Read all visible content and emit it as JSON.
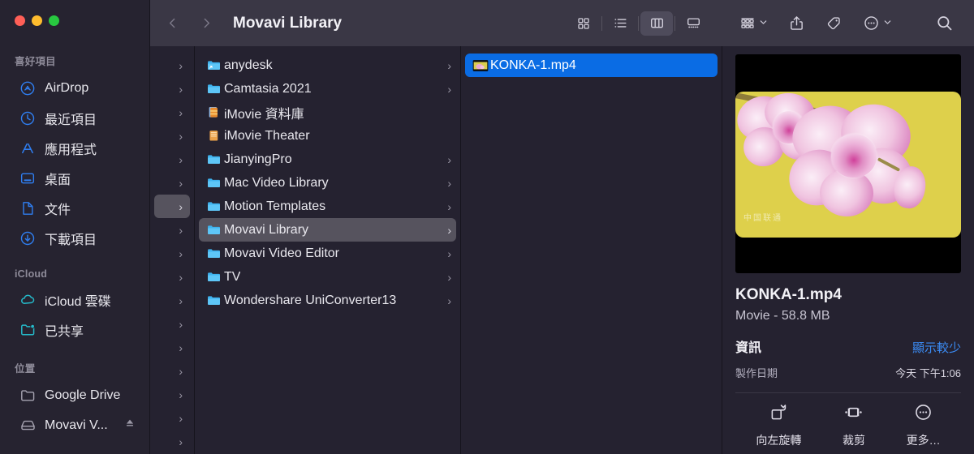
{
  "window": {
    "title": "Movavi Library",
    "traffic_lights": [
      "close",
      "minimize",
      "maximize"
    ],
    "colors": {
      "close": "#ff5f57",
      "minimize": "#febc2e",
      "maximize": "#28c840",
      "accent": "#0a6ce4",
      "link": "#3b8cf5"
    }
  },
  "toolbar": {
    "back_icon": "chevron-left-icon",
    "forward_icon": "chevron-right-icon",
    "title": "Movavi Library",
    "view_icon_label": "icon-view",
    "view_list_label": "list-view",
    "view_column_label": "column-view",
    "view_gallery_label": "gallery-view",
    "active_view": "column-view",
    "group_label": "group-by",
    "share_label": "share",
    "tag_label": "tag",
    "more_label": "more-actions",
    "search_label": "search"
  },
  "sidebar": {
    "sections": [
      {
        "header": "喜好項目",
        "items": [
          {
            "label": "AirDrop",
            "icon": "airdrop-icon"
          },
          {
            "label": "最近項目",
            "icon": "recents-clock-icon"
          },
          {
            "label": "應用程式",
            "icon": "applications-icon"
          },
          {
            "label": "桌面",
            "icon": "desktop-icon"
          },
          {
            "label": "文件",
            "icon": "documents-icon"
          },
          {
            "label": "下載項目",
            "icon": "downloads-icon"
          }
        ]
      },
      {
        "header": "iCloud",
        "items": [
          {
            "label": "iCloud 雲碟",
            "icon": "icloud-drive-icon"
          },
          {
            "label": "已共享",
            "icon": "shared-folder-icon"
          }
        ]
      },
      {
        "header": "位置",
        "items": [
          {
            "label": "Google Drive",
            "icon": "folder-icon"
          },
          {
            "label": "Movavi V...",
            "icon": "external-disk-icon",
            "eject": true
          }
        ]
      }
    ]
  },
  "columns": {
    "narrow_column": {
      "row_count": 16,
      "selected_index": 6,
      "chevron": "›"
    },
    "folder_column": {
      "items": [
        {
          "name": "anydesk",
          "icon": "folder-alias-icon",
          "chevron": true
        },
        {
          "name": "Camtasia 2021",
          "icon": "folder-icon",
          "chevron": true
        },
        {
          "name": "iMovie 資料庫",
          "icon": "imovie-library-icon",
          "chevron": false
        },
        {
          "name": "iMovie Theater",
          "icon": "imovie-theater-icon",
          "chevron": false
        },
        {
          "name": "JianyingPro",
          "icon": "folder-icon",
          "chevron": true
        },
        {
          "name": "Mac Video Library",
          "icon": "folder-icon",
          "chevron": true
        },
        {
          "name": "Motion Templates",
          "icon": "folder-icon",
          "chevron": true
        },
        {
          "name": "Movavi Library",
          "icon": "folder-icon",
          "chevron": true,
          "selected": true
        },
        {
          "name": "Movavi Video Editor",
          "icon": "folder-icon",
          "chevron": true
        },
        {
          "name": "TV",
          "icon": "folder-icon",
          "chevron": true
        },
        {
          "name": "Wondershare UniConverter13",
          "icon": "folder-icon",
          "chevron": true
        }
      ]
    },
    "file_column": {
      "items": [
        {
          "name": "KONKA-1.mp4",
          "icon": "movie-thumbnail-icon",
          "selected": true
        }
      ]
    }
  },
  "preview": {
    "thumbnail_alt": "pink orchid flowers on yellow background",
    "watermark": "中国联通",
    "filename": "KONKA-1.mp4",
    "kind_and_size": "Movie - 58.8 MB",
    "info_heading": "資訊",
    "show_less_link": "顯示較少",
    "info_rows": [
      {
        "key": "製作日期",
        "value": "今天 下午1:06"
      }
    ],
    "actions": [
      {
        "label": "向左旋轉",
        "icon": "rotate-left-icon"
      },
      {
        "label": "裁剪",
        "icon": "trim-icon"
      },
      {
        "label": "更多…",
        "icon": "ellipsis-circle-icon"
      }
    ]
  }
}
